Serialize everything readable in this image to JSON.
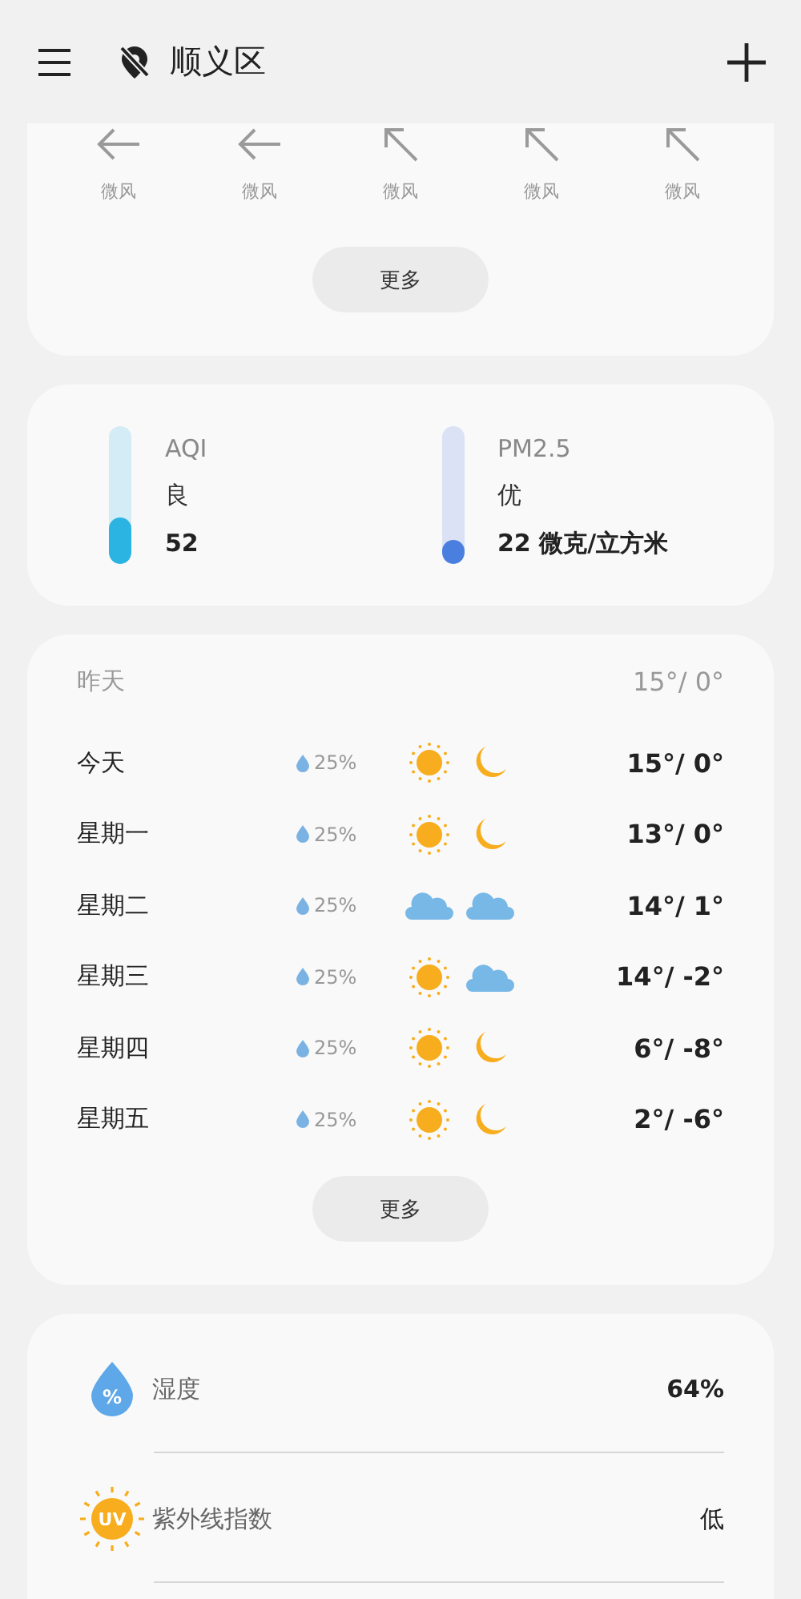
{
  "header": {
    "location": "顺义区"
  },
  "wind": {
    "items": [
      {
        "kind": "west",
        "label": "微风"
      },
      {
        "kind": "west",
        "label": "微风"
      },
      {
        "kind": "northwest",
        "label": "微风"
      },
      {
        "kind": "northwest",
        "label": "微风"
      },
      {
        "kind": "northwest",
        "label": "微风"
      }
    ],
    "more_button": "更多"
  },
  "air": [
    {
      "kind": "aqi",
      "name": "AQI",
      "grade": "良",
      "value": "52",
      "level": 0.34
    },
    {
      "kind": "pm25",
      "name": "PM2.5",
      "grade": "优",
      "value": "22 微克/立方米",
      "level": 0.18
    }
  ],
  "forecast": {
    "rows": [
      {
        "day": "昨天",
        "past": true,
        "temp": "15°/ 0°"
      },
      {
        "day": "今天",
        "past": false,
        "rain": "25%",
        "icons": [
          {
            "kind": "sun"
          },
          {
            "kind": "moon"
          }
        ],
        "temp": "15°/ 0°"
      },
      {
        "day": "星期一",
        "past": false,
        "rain": "25%",
        "icons": [
          {
            "kind": "sun"
          },
          {
            "kind": "moon"
          }
        ],
        "temp": "13°/ 0°"
      },
      {
        "day": "星期二",
        "past": false,
        "rain": "25%",
        "icons": [
          {
            "kind": "cloud"
          },
          {
            "kind": "cloud"
          }
        ],
        "temp": "14°/ 1°"
      },
      {
        "day": "星期三",
        "past": false,
        "rain": "25%",
        "icons": [
          {
            "kind": "sun"
          },
          {
            "kind": "cloud"
          }
        ],
        "temp": "14°/ -2°"
      },
      {
        "day": "星期四",
        "past": false,
        "rain": "25%",
        "icons": [
          {
            "kind": "sun"
          },
          {
            "kind": "moon"
          }
        ],
        "temp": "6°/ -8°"
      },
      {
        "day": "星期五",
        "past": false,
        "rain": "25%",
        "icons": [
          {
            "kind": "sun"
          },
          {
            "kind": "moon"
          }
        ],
        "temp": "2°/ -6°"
      }
    ],
    "more_button": "更多"
  },
  "details": [
    {
      "kind": "humidity",
      "icon_text": "%",
      "label": "湿度",
      "value": "64%"
    },
    {
      "kind": "uv",
      "icon_text": "UV",
      "label": "紫外线指数",
      "value": "低"
    }
  ]
}
